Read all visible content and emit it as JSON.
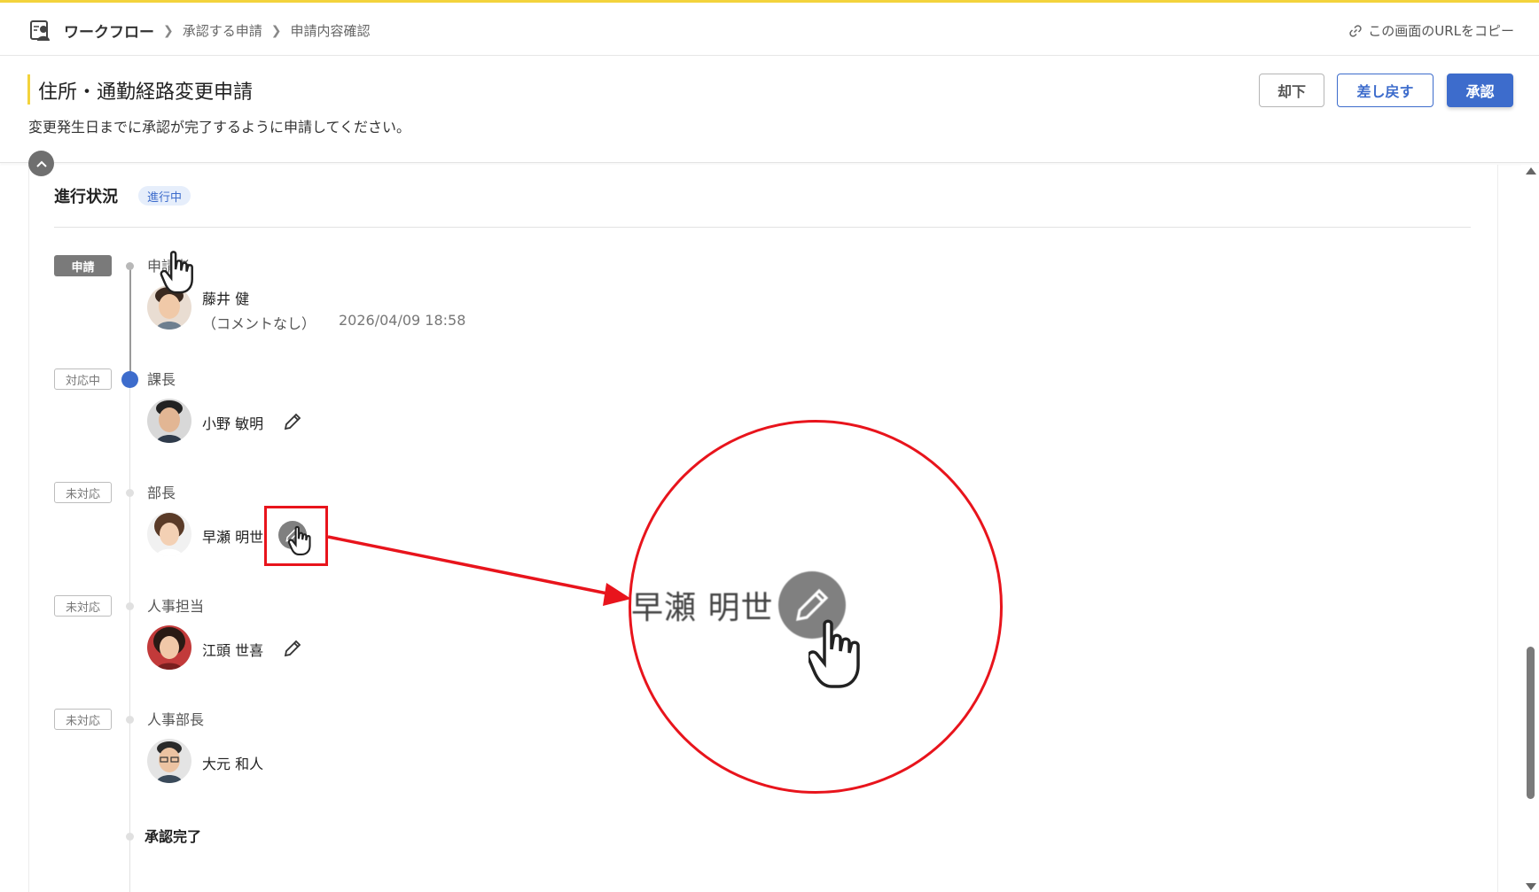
{
  "header": {
    "app_name": "ワークフロー",
    "breadcrumb_1": "承認する申請",
    "breadcrumb_2": "申請内容確認",
    "copy_url": "この画面のURLをコピー"
  },
  "request": {
    "title": "住所・通勤経路変更申請",
    "description": "変更発生日までに承認が完了するように申請してください。"
  },
  "actions": {
    "reject": "却下",
    "return": "差し戻す",
    "approve": "承認"
  },
  "progress": {
    "title": "進行状況",
    "status": "進行中",
    "steps": [
      {
        "tag": "申請",
        "role": "申請者",
        "person": "藤井 健",
        "comment": "（コメントなし）",
        "timestamp": "2026/04/09 18:58"
      },
      {
        "tag": "対応中",
        "role": "課長",
        "person": "小野 敏明"
      },
      {
        "tag": "未対応",
        "role": "部長",
        "person": "早瀬 明世"
      },
      {
        "tag": "未対応",
        "role": "人事担当",
        "person": "江頭 世喜"
      },
      {
        "tag": "未対応",
        "role": "人事部長",
        "person": "大元 和人"
      }
    ],
    "done_label": "承認完了"
  },
  "zoom": {
    "text": "早瀬 明世"
  },
  "colors": {
    "accent": "#3d6ccc",
    "brand_yellow": "#f3d33c",
    "annotation_red": "#e8141c"
  }
}
